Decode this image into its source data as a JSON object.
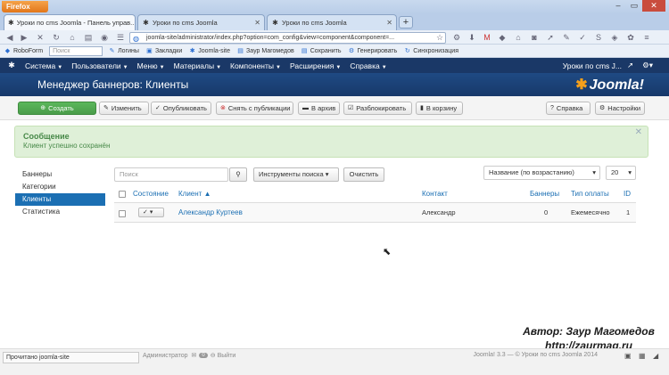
{
  "browser": {
    "app_button": "Firefox",
    "tabs": [
      {
        "title": "Уроки по cms Joomla - Панель управ...",
        "active": true
      },
      {
        "title": "Уроки по cms Joomla",
        "active": false
      },
      {
        "title": "Уроки по cms Joomla",
        "active": false
      }
    ],
    "new_tab": "+",
    "url": "joomla-site/administrator/index.php?option=com_config&view=component&component=...",
    "bookmarks": {
      "roboform": "RoboForm",
      "search_placeholder": "Поиск",
      "logins": "Логины",
      "bookmarks": "Закладки",
      "joomla": "Joomla-site",
      "zaur": "Заур Магомедов",
      "save": "Сохранить",
      "generate": "Генерировать",
      "sync": "Синхронизация"
    },
    "status": "Прочитано joomla-site"
  },
  "joomla": {
    "nav": [
      "Система",
      "Пользователи",
      "Меню",
      "Материалы",
      "Компоненты",
      "Расширения",
      "Справка"
    ],
    "site_link": "Уроки по cms J...",
    "page_title": "Менеджер баннеров: Клиенты",
    "brand": "Joomla!",
    "toolbar": {
      "create": "Создать",
      "edit": "Изменить",
      "publish": "Опубликовать",
      "unpublish": "Снять с публикации",
      "archive": "В архив",
      "unlock": "Разблокировать",
      "trash": "В корзину",
      "help": "Справка",
      "options": "Настройки"
    },
    "message": {
      "heading": "Сообщение",
      "text": "Клиент успешно сохранён"
    },
    "sidebar": [
      "Баннеры",
      "Категории",
      "Клиенты",
      "Статистика"
    ],
    "filters": {
      "search_placeholder": "Поиск",
      "search_tools": "Инструменты поиска",
      "clear": "Очистить",
      "sort": "Название (по возрастанию)",
      "limit": "20"
    },
    "table": {
      "headers": {
        "state": "Состояние",
        "client": "Клиент",
        "contact": "Контакт",
        "banners": "Баннеры",
        "purchase_type": "Тип оплаты",
        "id": "ID"
      },
      "rows": [
        {
          "client": "Александр Куртеев",
          "contact": "Александр",
          "banners": "0",
          "purchase_type": "Ежемесячно",
          "id": "1"
        }
      ]
    },
    "footer": {
      "admin": "Администратор",
      "count": "0",
      "logout": "Выйти",
      "copyright": "Joomla! 3.3 — © Уроки по cms Joomla 2014"
    }
  },
  "watermark": {
    "author": "Автор: Заур Магомедов",
    "site": "http://zaurmag.ru"
  }
}
